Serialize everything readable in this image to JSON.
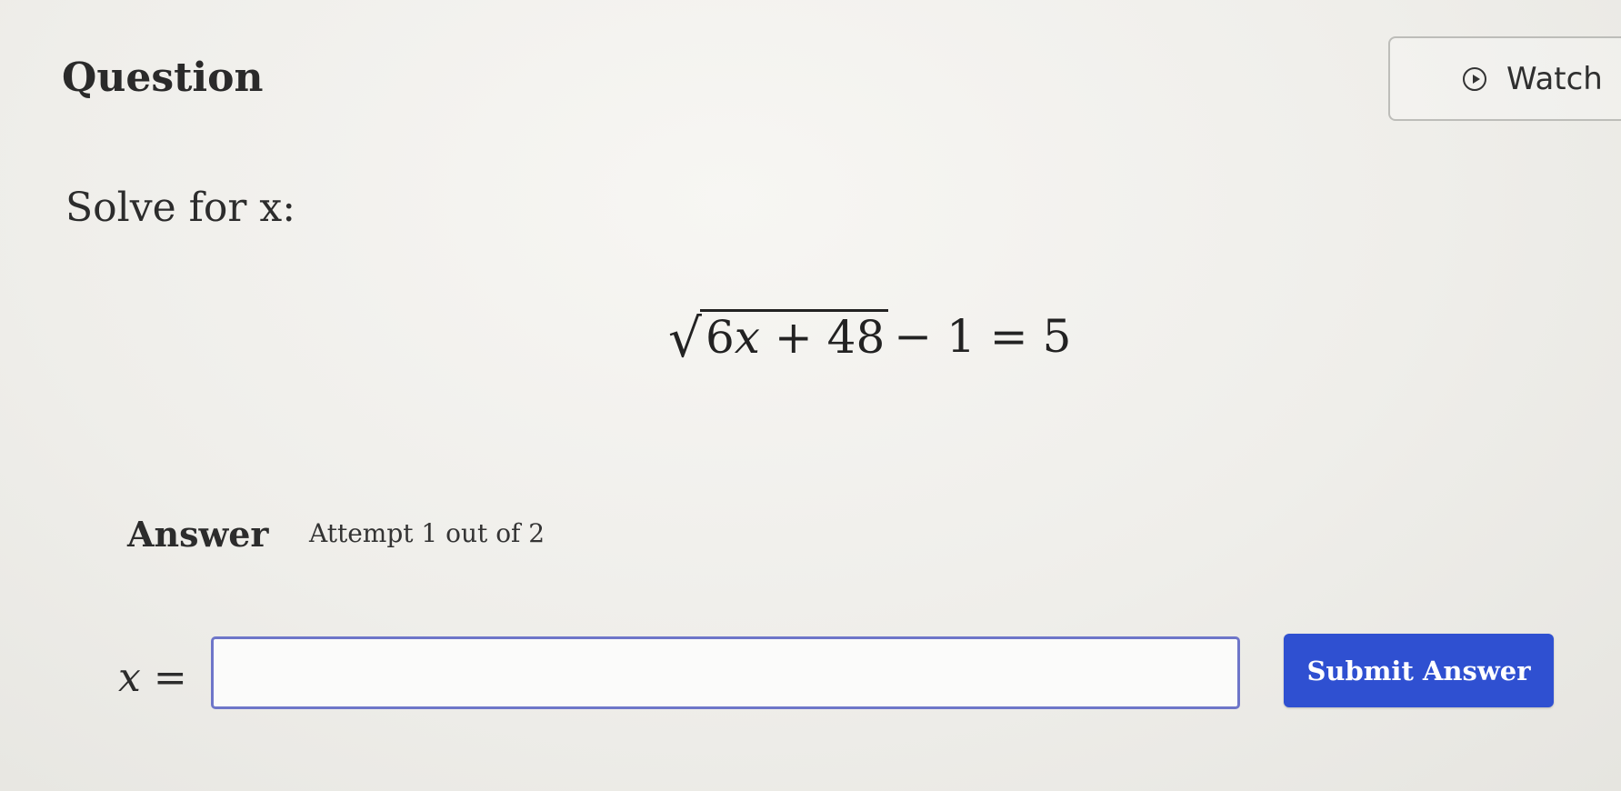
{
  "header": {
    "title": "Question",
    "watch_label": "Watch"
  },
  "question": {
    "prompt": "Solve for x:",
    "equation": {
      "radicand_coef": "6",
      "radicand_var": "x",
      "radicand_rest": " + 48",
      "rest": "− 1 = 5"
    }
  },
  "answer": {
    "label": "Answer",
    "attempt": "Attempt 1 out of 2",
    "variable": "x",
    "equals": " =",
    "input_value": "",
    "submit_label": "Submit Answer"
  },
  "colors": {
    "accent": "#2f50d1",
    "input_border": "#6e76c9"
  },
  "icons": {
    "watch": "play-circle-icon"
  }
}
